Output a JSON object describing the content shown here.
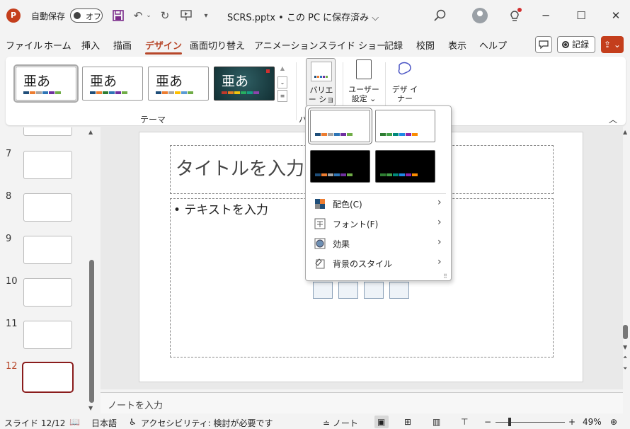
{
  "titlebar": {
    "app_logo": "P",
    "autosave_label": "自動保存",
    "autosave_state": "オフ",
    "doc_title": "SCRS.pptx • この PC に保存済み ⌵",
    "minimize": "─",
    "maximize": "☐",
    "close": "✕"
  },
  "tabs": [
    "ファイル",
    "ホーム",
    "挿入",
    "描画",
    "デザイン",
    "画面切り替え",
    "アニメーション",
    "スライド ショー",
    "記録",
    "校閲",
    "表示",
    "ヘルプ"
  ],
  "active_tab": "デザイン",
  "record_button": "記録",
  "ribbon": {
    "theme_glyph": "亜あ",
    "themes_group_label": "テーマ",
    "variations_label": "バリエー ション ⌄",
    "customize_label": "ユーザー 設定 ⌄",
    "designer_label": "デザ イナー",
    "variations_group_label_partial": "バ",
    "collapse": "︿"
  },
  "slides": [
    {
      "num": "7"
    },
    {
      "num": "8"
    },
    {
      "num": "9"
    },
    {
      "num": "10"
    },
    {
      "num": "11"
    },
    {
      "num": "12"
    }
  ],
  "slide": {
    "title_placeholder": "タイトルを入力",
    "body_placeholder": "• テキストを入力"
  },
  "notes_placeholder": "ノートを入力",
  "status": {
    "slide_info": "スライド 12/12",
    "language": "日本語",
    "accessibility": "アクセシビリティ: 検討が必要です",
    "notes": "≐ ノート",
    "zoom": "49%",
    "zoom_minus": "−",
    "zoom_plus": "+"
  },
  "dropdown": {
    "items": [
      {
        "label": "配色(C)",
        "icon": "color-scheme-icon"
      },
      {
        "label": "フォント(F)",
        "icon": "font-icon"
      },
      {
        "label": "効果",
        "icon": "effects-icon"
      },
      {
        "label": "背景のスタイル",
        "icon": "background-style-icon"
      }
    ]
  },
  "colors": {
    "accent": "#b7472a",
    "palette_light": [
      "#1f4e79",
      "#ed7d31",
      "#a5a5a5",
      "#2e75b6",
      "#7030a0",
      "#70ad47"
    ],
    "palette_green": [
      "#2e7d32",
      "#43a047",
      "#00897b",
      "#1e88e5",
      "#8e24aa",
      "#fb8c00"
    ]
  }
}
